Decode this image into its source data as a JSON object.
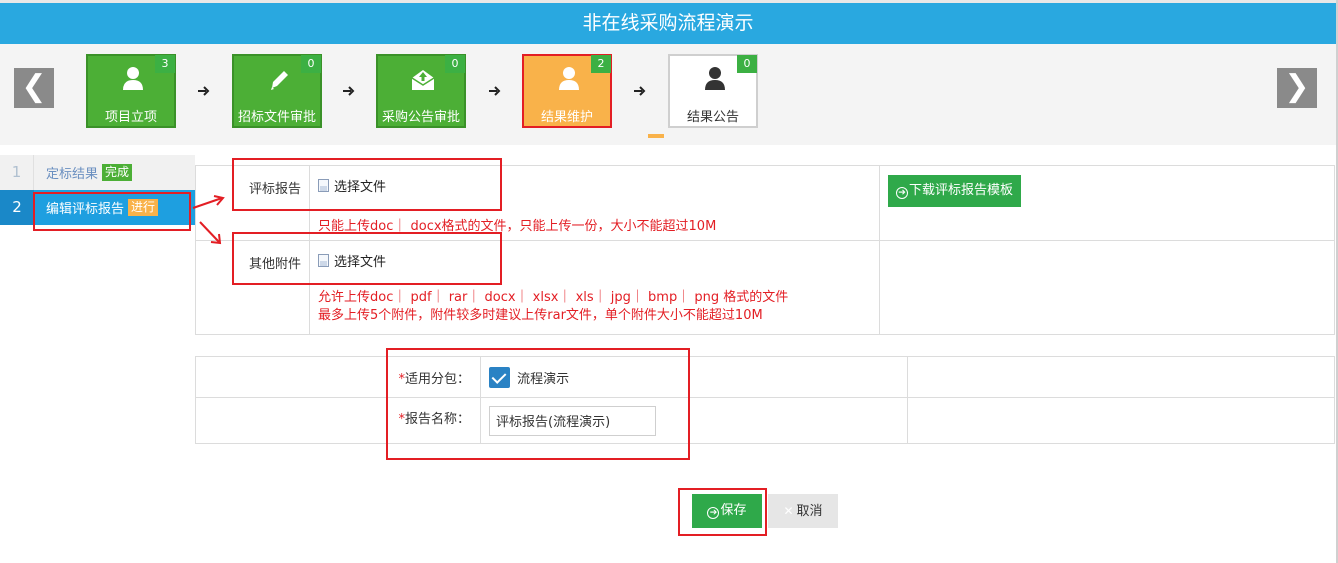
{
  "title": "非在线采购流程演示",
  "nav": {
    "prev": "❮",
    "next": "❯"
  },
  "steps": [
    {
      "label": "项目立项",
      "badge": "3",
      "state": "done",
      "icon": "user-icon"
    },
    {
      "label": "招标文件审批",
      "badge": "0",
      "state": "done",
      "icon": "pencil-icon"
    },
    {
      "label": "采购公告审批",
      "badge": "0",
      "state": "done",
      "icon": "mail-upload-icon"
    },
    {
      "label": "结果维护",
      "badge": "2",
      "state": "current",
      "icon": "user-icon"
    },
    {
      "label": "结果公告",
      "badge": "0",
      "state": "pending",
      "icon": "user-icon"
    }
  ],
  "sidebar": {
    "items": [
      {
        "num": "1",
        "label": "定标结果",
        "tag": "完成"
      },
      {
        "num": "2",
        "label": "编辑评标报告",
        "tag": "进行"
      }
    ]
  },
  "upload": {
    "report_label": "评标报告",
    "choose_file": "选择文件",
    "report_hint": "只能上传doc｜ docx格式的文件，只能上传一份，大小不能超过10M",
    "download_template": "下载评标报告模板",
    "other_label": "其他附件",
    "other_hint_1": "允许上传doc｜ pdf｜ rar｜ docx｜ xlsx｜ xls｜ jpg｜ bmp｜ png 格式的文件",
    "other_hint_2": "最多上传5个附件，附件较多时建议上传rar文件，单个附件大小不能超过10M"
  },
  "form": {
    "package_label": "适用分包：",
    "package_value": "流程演示",
    "package_checked": true,
    "name_label": "报告名称：",
    "name_value": "评标报告(流程演示)",
    "required_mark": "*"
  },
  "actions": {
    "save": "保存",
    "cancel": "取消"
  },
  "colors": {
    "header": "#29a8e0",
    "green": "#4caf36",
    "orange": "#f9b24a",
    "annotation_red": "#e31e24"
  }
}
